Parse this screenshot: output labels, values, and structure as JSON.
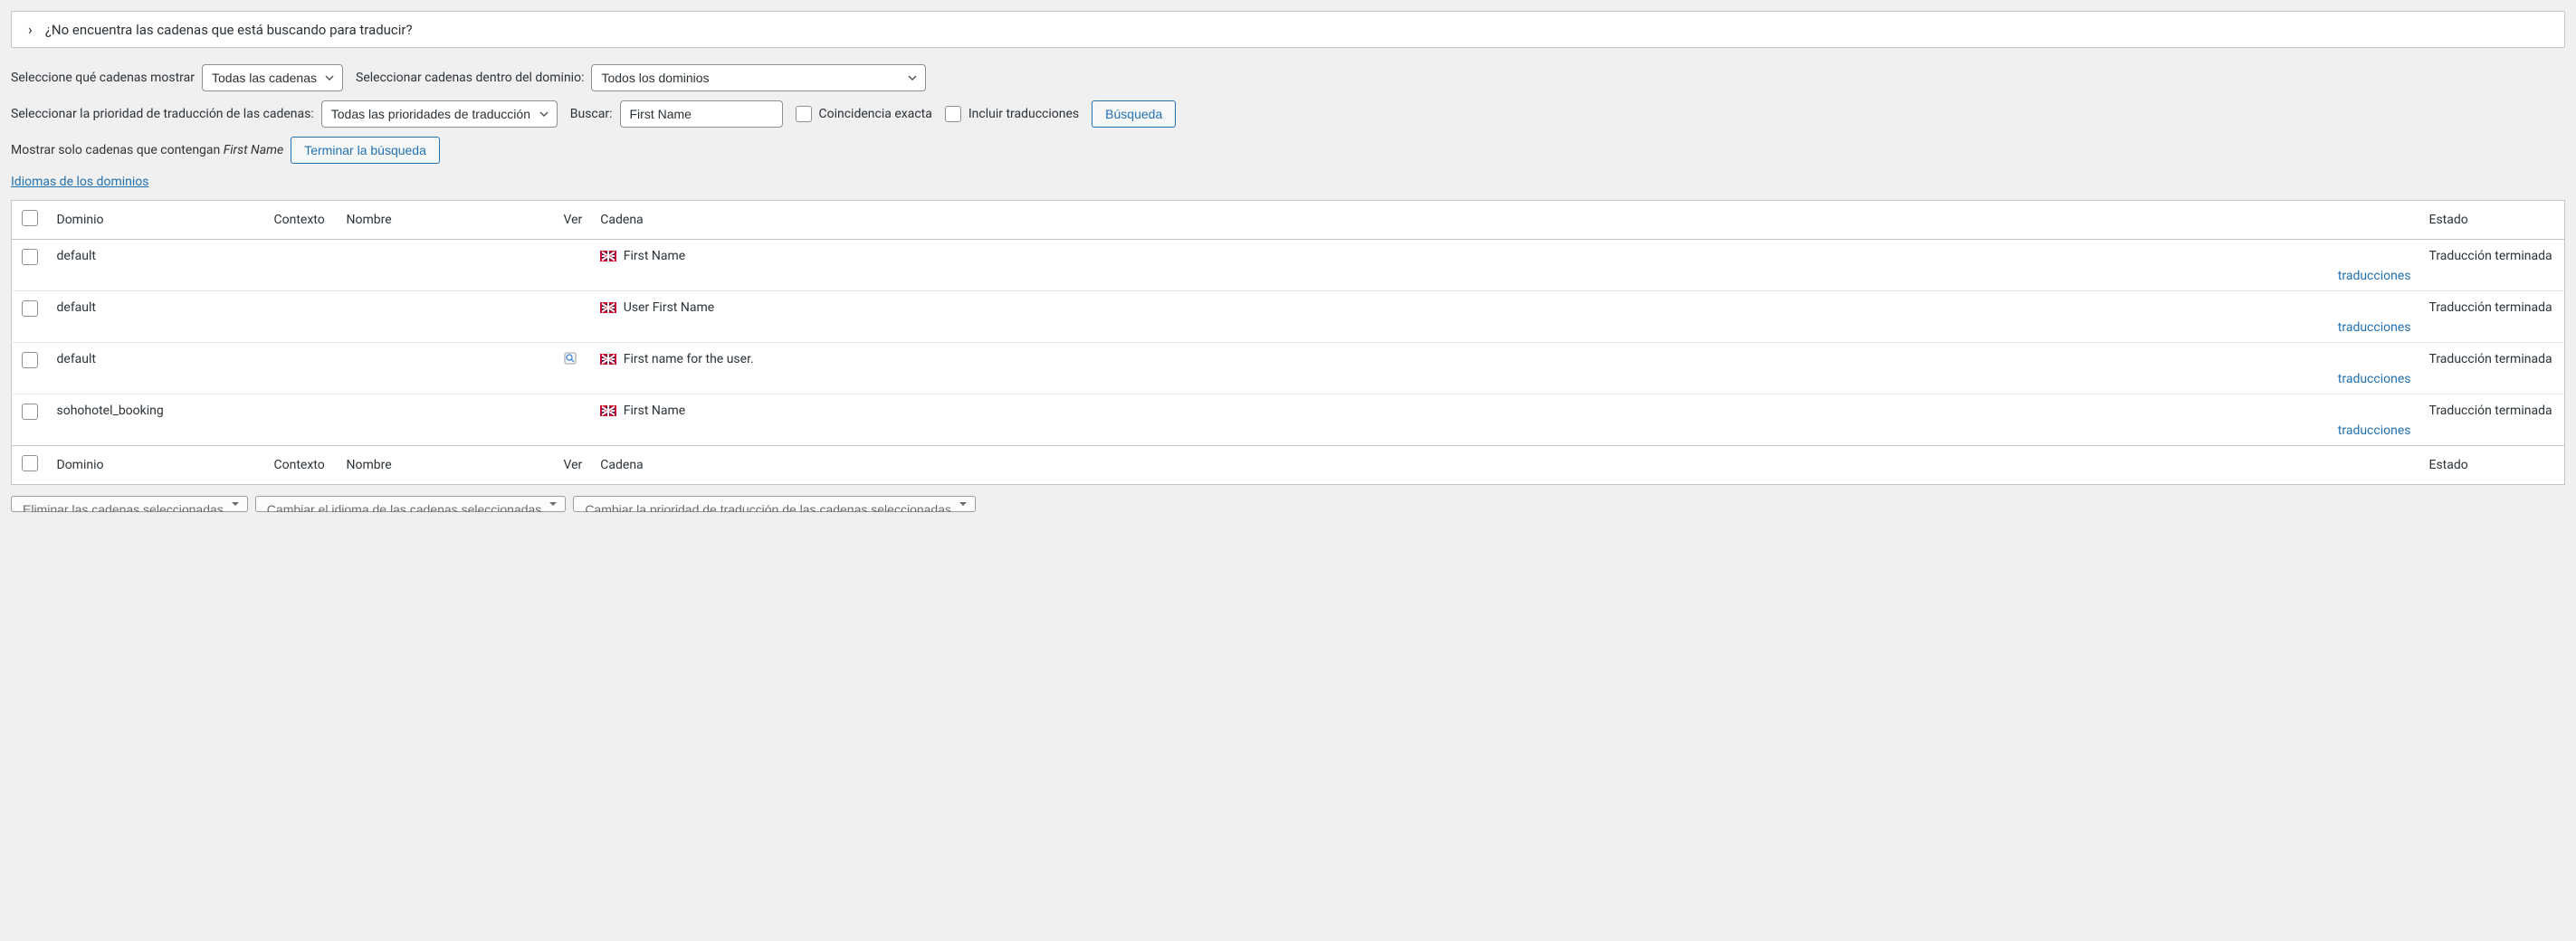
{
  "panel": {
    "help_text": "¿No encuentra las cadenas que está buscando para traducir?"
  },
  "filters": {
    "select_strings_label": "Seleccione qué cadenas mostrar",
    "select_strings_value": "Todas las cadenas",
    "domain_label": "Seleccionar cadenas dentro del dominio:",
    "domain_value": "Todos los dominios",
    "priority_label": "Seleccionar la prioridad de traducción de las cadenas:",
    "priority_value": "Todas las prioridades de traducción",
    "search_label": "Buscar:",
    "search_value": "First Name",
    "exact_match_label": "Coincidencia exacta",
    "include_translations_label": "Incluir traducciones",
    "search_button": "Búsqueda",
    "show_only_label": "Mostrar solo cadenas que contengan",
    "show_only_term": "First Name",
    "end_search_button": "Terminar la búsqueda",
    "domain_languages_link": "Idiomas de los dominios"
  },
  "table": {
    "headers": {
      "domain": "Dominio",
      "context": "Contexto",
      "name": "Nombre",
      "ver": "Ver",
      "string": "Cadena",
      "status": "Estado"
    },
    "rows": [
      {
        "domain": "default",
        "context": "",
        "name": "",
        "ver": "",
        "string": "First Name",
        "status": "Traducción terminada",
        "has_icon": false
      },
      {
        "domain": "default",
        "context": "",
        "name": "",
        "ver": "",
        "string": "User First Name",
        "status": "Traducción terminada",
        "has_icon": false
      },
      {
        "domain": "default",
        "context": "",
        "name": "",
        "ver": "icon",
        "string": "First name for the user.",
        "status": "Traducción terminada",
        "has_icon": true
      },
      {
        "domain": "sohohotel_booking",
        "context": "",
        "name": "",
        "ver": "",
        "string": "First Name",
        "status": "Traducción terminada",
        "has_icon": false
      }
    ],
    "translations_link": "traducciones"
  },
  "bottom_actions": {
    "delete": "Eliminar las cadenas seleccionadas",
    "change_lang": "Cambiar el idioma de las cadenas seleccionadas",
    "change_priority": "Cambiar la prioridad de traducción de las cadenas seleccionadas"
  }
}
